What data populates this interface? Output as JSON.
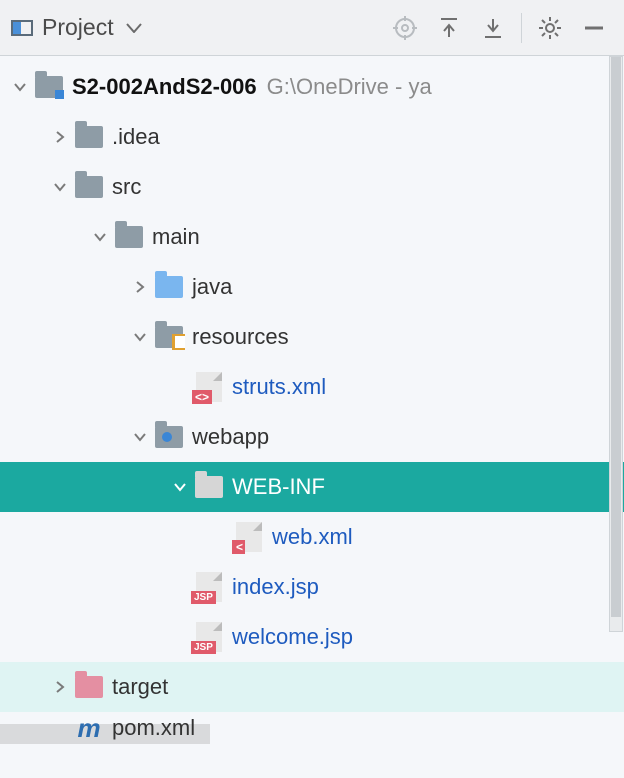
{
  "toolbar": {
    "title": "Project"
  },
  "tree": {
    "root": {
      "name": "S2-002AndS2-006",
      "path": "G:\\OneDrive - ya"
    },
    "idea": ".idea",
    "src": "src",
    "main": "main",
    "java": "java",
    "resources": "resources",
    "struts": "struts.xml",
    "webapp": "webapp",
    "webinf": "WEB-INF",
    "webxml": "web.xml",
    "indexjsp": "index.jsp",
    "welcomejsp": "welcome.jsp",
    "target": "target",
    "pom": "pom.xml"
  }
}
